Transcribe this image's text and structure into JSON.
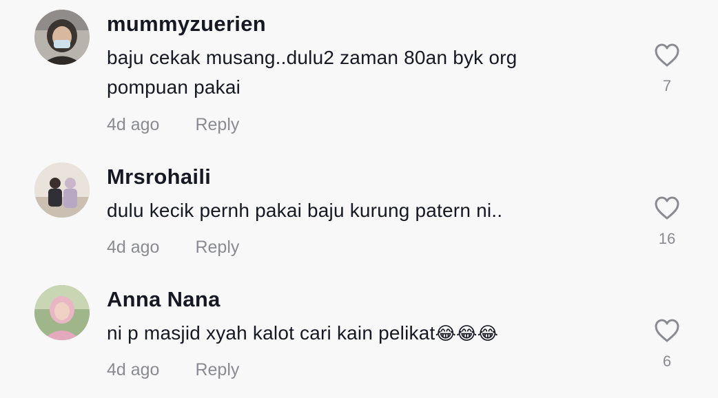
{
  "comments": [
    {
      "username": "mummyzuerien",
      "text": "baju cekak musang..dulu2 zaman 80an byk org pompuan pakai",
      "time": "4d ago",
      "reply_label": "Reply",
      "likes": "7"
    },
    {
      "username": "Mrsrohaili",
      "text": "dulu kecik pernh pakai baju kurung patern ni..",
      "time": "4d ago",
      "reply_label": "Reply",
      "likes": "16"
    },
    {
      "username": "Anna Nana",
      "text": "ni p masjid xyah kalot cari kain pelikat",
      "emoji": "😂😂😂",
      "time": "4d ago",
      "reply_label": "Reply",
      "likes": "6"
    }
  ],
  "icons": {
    "like": "heart-outline-icon"
  },
  "colors": {
    "background": "#f8f8f8",
    "username": "#161823",
    "secondary_text": "#8a8b91"
  }
}
